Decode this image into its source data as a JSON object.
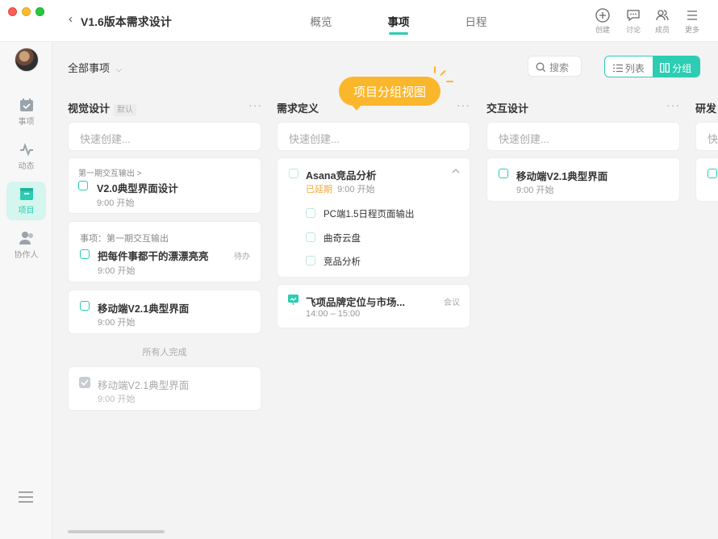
{
  "titlebar": {
    "back_icon": "chevron-left-icon",
    "project_title": "V1.6版本需求设计",
    "tabs": [
      {
        "label": "概览",
        "active": false
      },
      {
        "label": "事项",
        "active": true
      },
      {
        "label": "日程",
        "active": false
      }
    ],
    "tools": [
      {
        "label": "创建",
        "icon": "plus-circle-icon"
      },
      {
        "label": "讨论",
        "icon": "chat-icon"
      },
      {
        "label": "成员",
        "icon": "members-icon"
      },
      {
        "label": "更多",
        "icon": "menu-icon"
      }
    ]
  },
  "sidebar": {
    "items": [
      {
        "label": "事项",
        "icon": "task-icon",
        "active": false
      },
      {
        "label": "动态",
        "icon": "activity-icon",
        "active": false
      },
      {
        "label": "项目",
        "icon": "project-icon",
        "active": true
      },
      {
        "label": "协作人",
        "icon": "collaborators-icon",
        "active": false
      }
    ]
  },
  "toolbar": {
    "filter_label": "全部事项",
    "search_label": "搜索",
    "view_list": "列表",
    "view_group": "分组"
  },
  "tooltip": "项目分组视图",
  "columns": [
    {
      "title": "视觉设计",
      "tag": "默认",
      "quick_create": "快速创建...",
      "cards": [
        {
          "sub": "第一期交互输出 >",
          "title": "V2.0典型界面设计",
          "time": "9:00 开始"
        },
        {
          "sub": "事项：第一期交互输出",
          "title": "把每件事都干的漂漂亮亮",
          "time": "9:00 开始",
          "status": "待办"
        },
        {
          "title": "移动端V2.1典型界面",
          "time": "9:00 开始"
        }
      ],
      "divider": "所有人完成",
      "done_cards": [
        {
          "title": "移动端V2.1典型界面",
          "time": "9:00 开始"
        }
      ]
    },
    {
      "title": "需求定义",
      "quick_create": "快速创建...",
      "cards": [
        {
          "title": "Asana竞品分析",
          "overdue": "已延期",
          "time": "9:00 开始",
          "subtasks": [
            "PC端1.5日程页面输出",
            "曲奇云盘",
            "竞品分析"
          ]
        },
        {
          "title": "飞项品牌定位与市场...",
          "time": "14:00 – 15:00",
          "status": "会议"
        }
      ]
    },
    {
      "title": "交互设计",
      "quick_create": "快速创建...",
      "cards": [
        {
          "title": "移动端V2.1典型界面",
          "time": "9:00 开始"
        }
      ]
    },
    {
      "title": "研发",
      "quick_create": "快"
    }
  ],
  "colors": {
    "accent": "#2ccdb2",
    "tooltip": "#fbb72c",
    "overdue": "#f3a63a"
  }
}
